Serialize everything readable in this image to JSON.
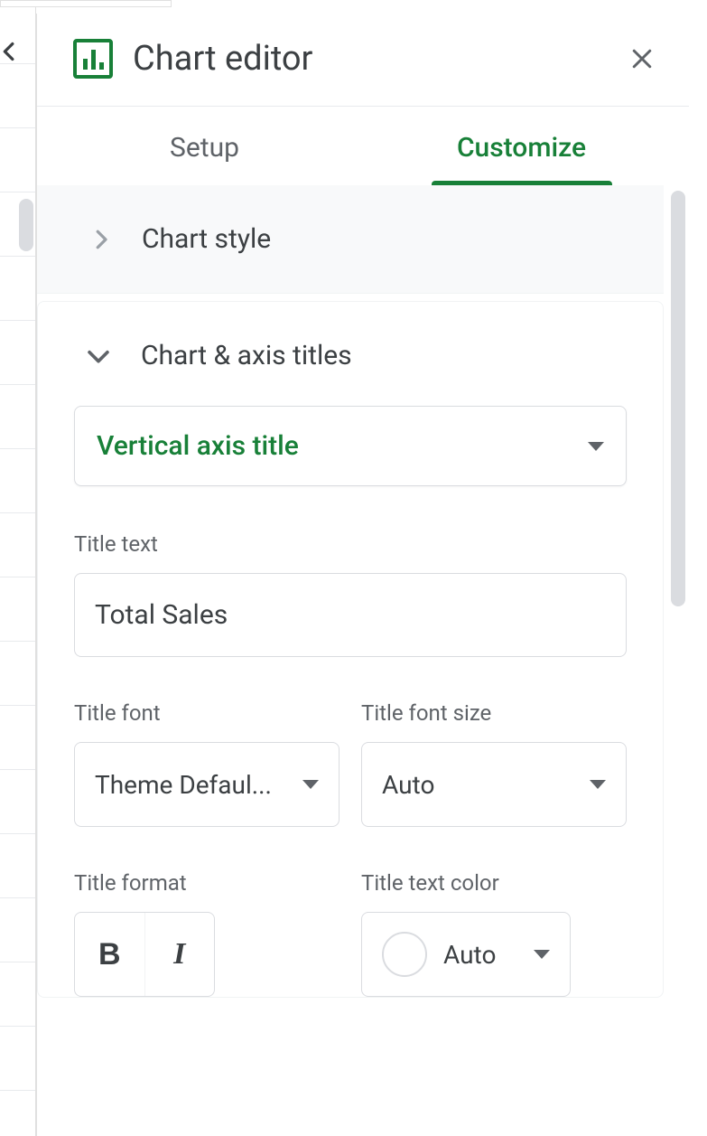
{
  "header": {
    "title": "Chart editor"
  },
  "tabs": {
    "setup": "Setup",
    "customize": "Customize"
  },
  "sections": {
    "chart_style": "Chart style",
    "axis_titles": "Chart & axis titles"
  },
  "title_type_select": {
    "value": "Vertical axis title"
  },
  "fields": {
    "title_text_label": "Title text",
    "title_text_value": "Total Sales",
    "title_font_label": "Title font",
    "title_font_value": "Theme Defaul...",
    "title_font_size_label": "Title font size",
    "title_font_size_value": "Auto",
    "title_format_label": "Title format",
    "title_text_color_label": "Title text color",
    "title_text_color_value": "Auto"
  }
}
